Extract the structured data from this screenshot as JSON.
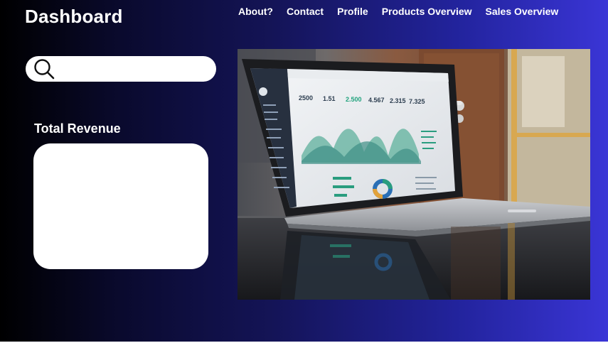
{
  "header": {
    "title": "Dashboard"
  },
  "nav": {
    "items": [
      {
        "label": "About?"
      },
      {
        "label": "Contact"
      },
      {
        "label": "Profile"
      },
      {
        "label": "Products Overview"
      },
      {
        "label": "Sales Overview"
      }
    ]
  },
  "search": {
    "icon": "search-icon",
    "value": "",
    "placeholder": ""
  },
  "revenue": {
    "label": "Total Revenue"
  },
  "hero_image": {
    "description_icon": "laptop-dashboard-photo"
  },
  "colors": {
    "gradient_start": "#000000",
    "gradient_end": "#3a35d6",
    "card": "#ffffff"
  }
}
